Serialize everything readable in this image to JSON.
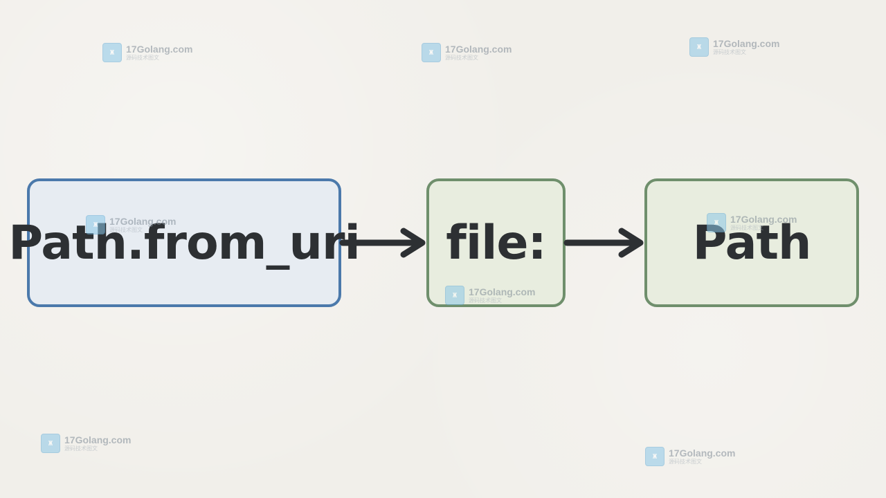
{
  "diagram": {
    "nodes": [
      {
        "id": "path-from-uri",
        "label": "Path.from_uri"
      },
      {
        "id": "file-scheme",
        "label": "file:"
      },
      {
        "id": "path",
        "label": "Path"
      }
    ],
    "edges": [
      {
        "from": "path-from-uri",
        "to": "file-scheme"
      },
      {
        "from": "file-scheme",
        "to": "path"
      }
    ]
  },
  "watermark": {
    "domain": "17Golang.com",
    "tagline": "源码技术图文",
    "logo_text": "Ж"
  },
  "colors": {
    "background": "#f1efea",
    "blue_border": "#4b79ab",
    "blue_fill": "#e7ecf2",
    "green_border": "#6f8f6c",
    "green_fill": "#e8eddf",
    "text": "#2d3033",
    "arrow": "#2d3033"
  }
}
